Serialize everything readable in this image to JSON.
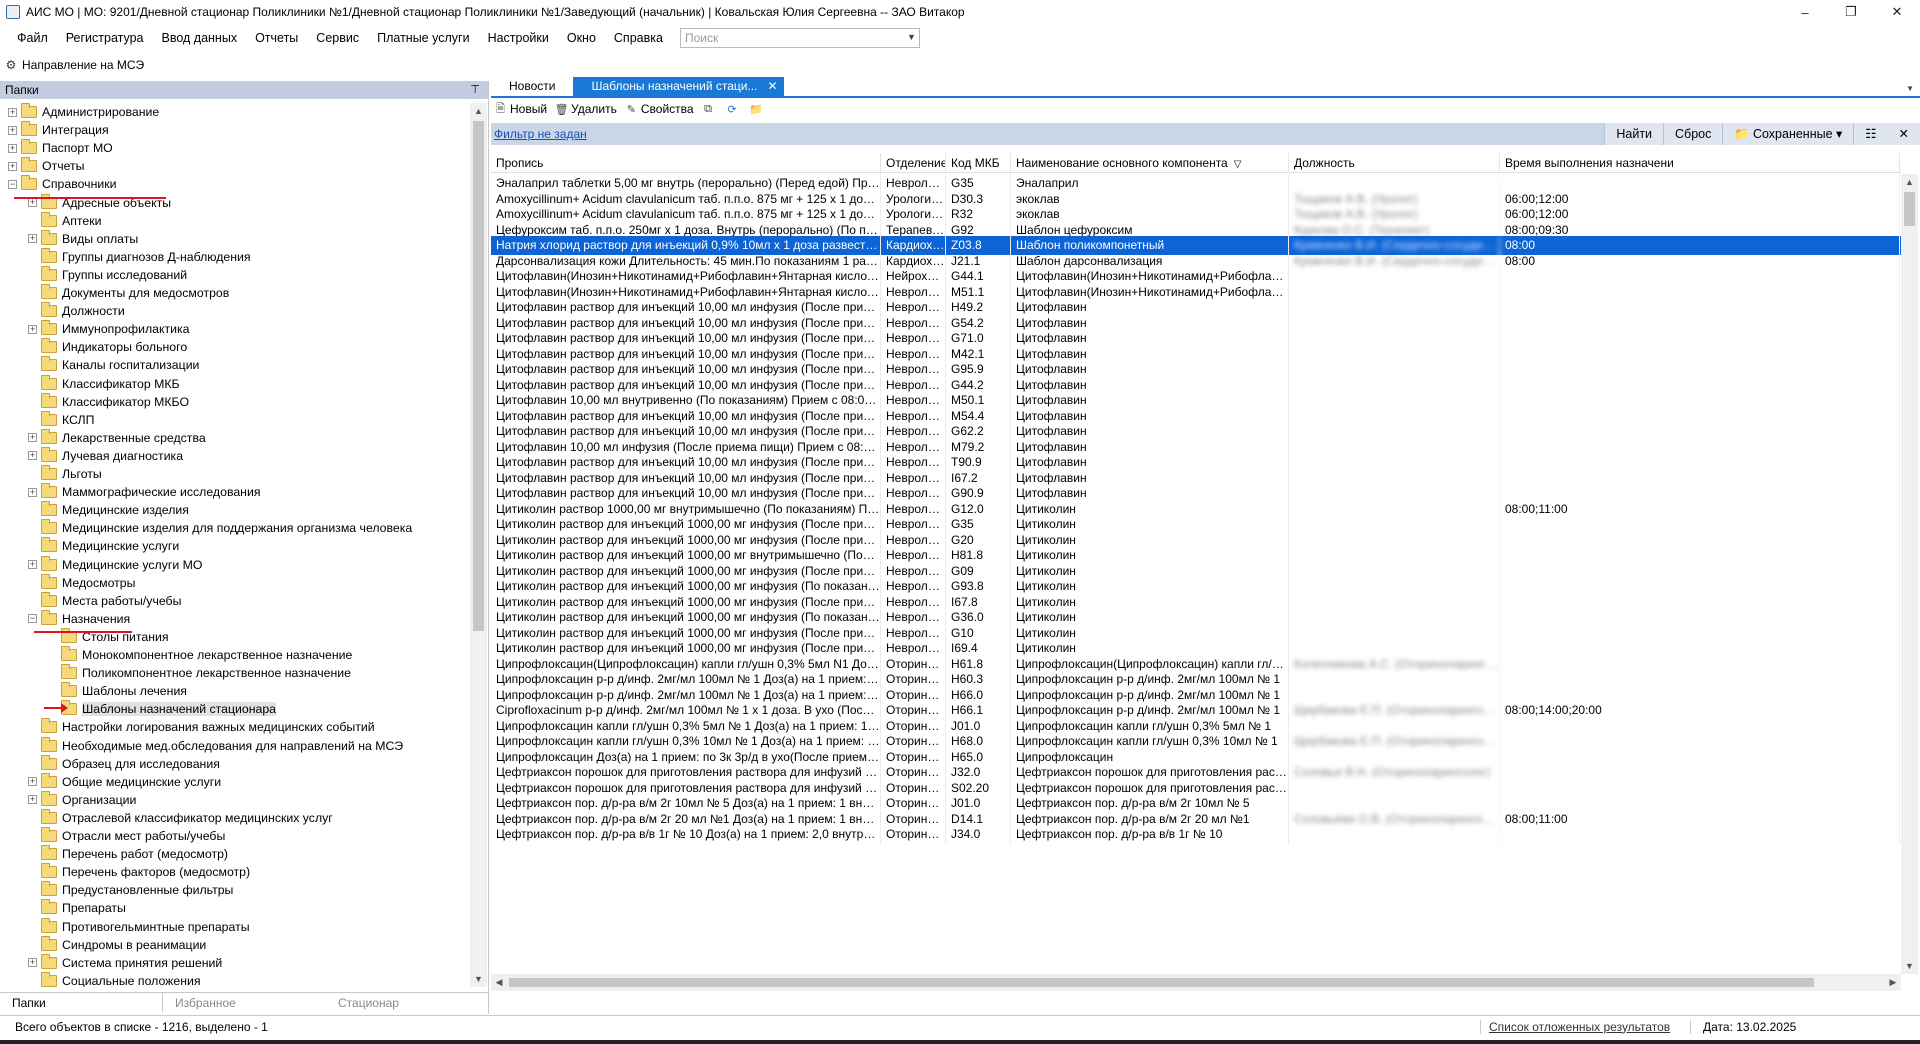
{
  "window": {
    "title": "АИС МО | МО: 9201/Дневной стационар Поликлиники №1/Дневной стационар Поликлиники №1/Заведующий (начальник) | Ковальская Юлия Сергеевна -- ЗАО Витакор"
  },
  "menu": {
    "items": [
      "Файл",
      "Регистратура",
      "Ввод данных",
      "Отчеты",
      "Сервис",
      "Платные услуги",
      "Настройки",
      "Окно",
      "Справка"
    ],
    "search_placeholder": "Поиск"
  },
  "toolbar1": {
    "mse_label": "Направление на МСЭ"
  },
  "left_panel": {
    "header": "Папки",
    "tree": [
      {
        "label": "Администрирование",
        "level": 0,
        "expandable": true
      },
      {
        "label": "Интеграция",
        "level": 0,
        "expandable": true
      },
      {
        "label": "Паспорт МО",
        "level": 0,
        "expandable": true
      },
      {
        "label": "Отчеты",
        "level": 0,
        "expandable": true
      },
      {
        "label": "Справочники",
        "level": 0,
        "expandable": true,
        "expanded": true
      },
      {
        "label": "Адресные объекты",
        "level": 1,
        "expandable": true
      },
      {
        "label": "Аптеки",
        "level": 1,
        "expandable": false
      },
      {
        "label": "Виды оплаты",
        "level": 1,
        "expandable": true
      },
      {
        "label": "Группы диагнозов Д-наблюдения",
        "level": 1,
        "expandable": false
      },
      {
        "label": "Группы исследований",
        "level": 1,
        "expandable": false
      },
      {
        "label": "Документы для медосмотров",
        "level": 1,
        "expandable": false
      },
      {
        "label": "Должности",
        "level": 1,
        "expandable": false
      },
      {
        "label": "Иммунопрофилактика",
        "level": 1,
        "expandable": true
      },
      {
        "label": "Индикаторы больного",
        "level": 1,
        "expandable": false
      },
      {
        "label": "Каналы госпитализации",
        "level": 1,
        "expandable": false
      },
      {
        "label": "Классификатор МКБ",
        "level": 1,
        "expandable": false
      },
      {
        "label": "Классификатор МКБО",
        "level": 1,
        "expandable": false
      },
      {
        "label": "КСЛП",
        "level": 1,
        "expandable": false
      },
      {
        "label": "Лекарственные средства",
        "level": 1,
        "expandable": true
      },
      {
        "label": "Лучевая диагностика",
        "level": 1,
        "expandable": true
      },
      {
        "label": "Льготы",
        "level": 1,
        "expandable": false
      },
      {
        "label": "Маммографические исследования",
        "level": 1,
        "expandable": true
      },
      {
        "label": "Медицинские изделия",
        "level": 1,
        "expandable": false
      },
      {
        "label": "Медицинские изделия для поддержания организма человека",
        "level": 1,
        "expandable": false
      },
      {
        "label": "Медицинские услуги",
        "level": 1,
        "expandable": false
      },
      {
        "label": "Медицинские услуги МО",
        "level": 1,
        "expandable": true
      },
      {
        "label": "Медосмотры",
        "level": 1,
        "expandable": false
      },
      {
        "label": "Места работы/учебы",
        "level": 1,
        "expandable": false
      },
      {
        "label": "Назначения",
        "level": 1,
        "expandable": true,
        "expanded": true
      },
      {
        "label": "Столы питания",
        "level": 2,
        "expandable": false
      },
      {
        "label": "Монокомпонентное лекарственное назначение",
        "level": 2,
        "expandable": false
      },
      {
        "label": "Поликомпонентное лекарственное назначение",
        "level": 2,
        "expandable": false
      },
      {
        "label": "Шаблоны лечения",
        "level": 2,
        "expandable": false
      },
      {
        "label": "Шаблоны назначений стационара",
        "level": 2,
        "expandable": false,
        "selected": true
      },
      {
        "label": "Настройки логирования важных медицинских событий",
        "level": 1,
        "expandable": false
      },
      {
        "label": "Необходимые мед.обследования для направлений на МСЭ",
        "level": 1,
        "expandable": false
      },
      {
        "label": "Образец для исследования",
        "level": 1,
        "expandable": false
      },
      {
        "label": "Общие медицинские услуги",
        "level": 1,
        "expandable": true
      },
      {
        "label": "Организации",
        "level": 1,
        "expandable": true
      },
      {
        "label": "Отраслевой классификатор медицинских услуг",
        "level": 1,
        "expandable": false
      },
      {
        "label": "Отрасли мест работы/учебы",
        "level": 1,
        "expandable": false
      },
      {
        "label": "Перечень работ (медосмотр)",
        "level": 1,
        "expandable": false
      },
      {
        "label": "Перечень факторов (медосмотр)",
        "level": 1,
        "expandable": false
      },
      {
        "label": "Предустановленные фильтры",
        "level": 1,
        "expandable": false
      },
      {
        "label": "Препараты",
        "level": 1,
        "expandable": false
      },
      {
        "label": "Противогельминтные препараты",
        "level": 1,
        "expandable": false
      },
      {
        "label": "Синдромы в реанимации",
        "level": 1,
        "expandable": false
      },
      {
        "label": "Система принятия решений",
        "level": 1,
        "expandable": true
      },
      {
        "label": "Социальные положения",
        "level": 1,
        "expandable": false
      }
    ],
    "bottom_tabs": [
      "Папки",
      "Избранное",
      "Стационар"
    ]
  },
  "right_panel": {
    "tabs": [
      "Новости",
      "Шаблоны назначений стаци..."
    ],
    "toolbar": {
      "new": "Новый",
      "delete": "Удалить",
      "properties": "Свойства"
    },
    "filter_link": "Фильтр не задан",
    "filter_buttons": {
      "find": "Найти",
      "reset": "Сброс",
      "saved": "Сохраненные"
    },
    "columns": [
      "Пропись",
      "Отделение",
      "Код МКБ",
      "Наименование основного компонента",
      "Должность",
      "Время выполнения назначени"
    ],
    "rows": [
      [
        "Эналаприл таблетки 5,00 мг  внутрь (перорально) (Перед едой)   Прием с 08:00 до 1...",
        "Невролог...",
        "G35",
        "Эналаприл",
        "",
        ""
      ],
      [
        "Amoxycillinum+ Acidum clavulanicum таб. п.п.о. 875 мг + 125 х 1 доза. Внутрь (перо...",
        "Урологич...",
        "D30.3",
        "экоклав",
        "Тощаков А.В. (Уролог)",
        "06:00;12:00"
      ],
      [
        "Amoxycillinum+ Acidum clavulanicum таб. п.п.о. 875 мг + 125 х 1 доза. Внутрь (перо...",
        "Урологич...",
        "R32",
        "экоклав",
        "Тощаков А.В. (Уролог)",
        "06:00;12:00"
      ],
      [
        "Цефуроксим таб. п.п.о. 250мг х 1 доза. Внутрь (перорально) (По показаниям) 2 раз...",
        "Терапевти...",
        "G92",
        "Шаблон цефуроксим",
        "Куркова О.С. (Терапевт)",
        "08:00;09:30"
      ],
      [
        "Натрия хлорид раствор для инъекций 0,9% 10мл х 1 доза развести в Цефазолин по...",
        "Кардиохи...",
        "Z03.8",
        "Шаблон поликомпонетный",
        "Кравченко В.И. (Сердечно-сосудистый хир...",
        "08:00"
      ],
      [
        "Дарсонвализация кожи Длительность: 45 мин.По показаниям 1 раз ежедневно в 08:0...",
        "Кардиохи...",
        "J21.1",
        "Шаблон дарсонвализация",
        "Кравченко В.И. (Сердечно-сосудистый хир...",
        "08:00"
      ],
      [
        "Цитофлавин(Инозин+Никотинамид+Рибофлавин+Янтарная кислота) раствор для ...",
        "Нейрохир...",
        "G44.1",
        "Цитофлавин(Инозин+Никотинамид+Рибофлавин+Янтар...",
        "",
        ""
      ],
      [
        "Цитофлавин(Инозин+Никотинамид+Рибофлавин+Янтарная кислота) раствор для ...",
        "Невролог...",
        "M51.1",
        "Цитофлавин(Инозин+Никотинамид+Рибофлавин+Янтар...",
        "",
        ""
      ],
      [
        "Цитофлавин раствор для инъекций 10,00 мл  инфузия (После приема пищи)   При...",
        "Невролог...",
        "H49.2",
        "Цитофлавин",
        "",
        ""
      ],
      [
        "Цитофлавин раствор для инъекций 10,00 мл  инфузия (После приема пищи)   При...",
        "Невролог...",
        "G54.2",
        "Цитофлавин",
        "",
        ""
      ],
      [
        "Цитофлавин раствор для инъекций 10,00 мл  инфузия (После приема пищи)   При...",
        "Невролог...",
        "G71.0",
        "Цитофлавин",
        "",
        ""
      ],
      [
        "Цитофлавин раствор для инъекций 10,00 мл  инфузия (После приема пищи)   При...",
        "Невролог...",
        "M42.1",
        "Цитофлавин",
        "",
        ""
      ],
      [
        "Цитофлавин раствор для инъекций 10,00 мл  инфузия (После приема пищи)   При...",
        "Невролог...",
        "G95.9",
        "Цитофлавин",
        "",
        ""
      ],
      [
        "Цитофлавин раствор для инъекций 10,00 мл  инфузия (После приема пищи)   При...",
        "Невролог...",
        "G44.2",
        "Цитофлавин",
        "",
        ""
      ],
      [
        "Цитофлавин 10,00 мл  внутривенно (По показаниям)   Прием с 08:00 до 11:00. 1 раз ...",
        "Невролог...",
        "M50.1",
        "Цитофлавин",
        "",
        ""
      ],
      [
        "Цитофлавин раствор для инъекций 10,00 мл  инфузия (После приема пищи)   При...",
        "Невролог...",
        "M54.4",
        "Цитофлавин",
        "",
        ""
      ],
      [
        "Цитофлавин раствор для инъекций 10,00 мл  инфузия (После приема пищи)   При...",
        "Невролог...",
        "G62.2",
        "Цитофлавин",
        "",
        ""
      ],
      [
        "Цитофлавин 10,00 мл  инфузия (После приема пищи)   Прием с 08:00 до 11:00. 1 ра...",
        "Невролог...",
        "M79.2",
        "Цитофлавин",
        "",
        ""
      ],
      [
        "Цитофлавин раствор для инъекций 10,00 мл  инфузия (После приема пищи)   При...",
        "Невролог...",
        "T90.9",
        "Цитофлавин",
        "",
        ""
      ],
      [
        "Цитофлавин раствор для инъекций 10,00 мл  инфузия (После приема пищи)   При...",
        "Невролог...",
        "I67.2",
        "Цитофлавин",
        "",
        ""
      ],
      [
        "Цитофлавин раствор для инъекций 10,00 мл  инфузия (После приема пищи)   При...",
        "Невролог...",
        "G90.9",
        "Цитофлавин",
        "",
        ""
      ],
      [
        "Цитиколин раствор 1000,00 мг  внутримышечно (По показаниям)   Прием с 08:00 д...",
        "Невролог...",
        "G12.0",
        "Цитиколин",
        "",
        "08:00;11:00"
      ],
      [
        "Цитиколин раствор для инъекций 1000,00 мг  инфузия (После приема пищи)   При...",
        "Невролог...",
        "G35",
        "Цитиколин",
        "",
        ""
      ],
      [
        "Цитиколин раствор для инъекций 1000,00 мг  инфузия (После приема пищи)   При...",
        "Невролог...",
        "G20",
        "Цитиколин",
        "",
        ""
      ],
      [
        "Цитиколин раствор для инъекций 1000,00 мг  внутримышечно (После приема пи...",
        "Невролог...",
        "H81.8",
        "Цитиколин",
        "",
        ""
      ],
      [
        "Цитиколин раствор для инъекций 1000,00 мг  инфузия (После приема пищи)   При...",
        "Невролог...",
        "G09",
        "Цитиколин",
        "",
        ""
      ],
      [
        "Цитиколин раствор для инъекций 1000,00 мг  инфузия (По показаниям)   Прием с 0...",
        "Невролог...",
        "G93.8",
        "Цитиколин",
        "",
        ""
      ],
      [
        "Цитиколин раствор для инъекций 1000,00 мг  инфузия (После приема пищи)   При...",
        "Невролог...",
        "I67.8",
        "Цитиколин",
        "",
        ""
      ],
      [
        "Цитиколин раствор для инъекций 1000,00 мг  инфузия (По показаниям)   Прием с 0...",
        "Невролог...",
        "G36.0",
        "Цитиколин",
        "",
        ""
      ],
      [
        "Цитиколин раствор для инъекций 1000,00 мг  инфузия (После приема пищи)   При...",
        "Невролог...",
        "G10",
        "Цитиколин",
        "",
        ""
      ],
      [
        "Цитиколин раствор для инъекций 1000,00 мг  инфузия (После приема пищи)   При...",
        "Невролог...",
        "I69.4",
        "Цитиколин",
        "",
        ""
      ],
      [
        "Ципрофлоксацин(Ципрофлоксацин) капли гл/ушн 0,3% 5мл N1 Доз(а) на 1 прием:...",
        "Оторинол...",
        "H61.8",
        "Ципрофлоксацин(Ципрофлоксацин) капли гл/ушн 0,3% ...",
        "Колесникова А.С. (Оториноларинголог)",
        ""
      ],
      [
        "Ципрофлоксацин р-р д/инф. 2мг/мл 100мл № 1 Доз(а) на 1 прием: по 3к в правое ...",
        "Оторинол...",
        "H60.3",
        "Ципрофлоксацин р-р д/инф. 2мг/мл 100мл № 1",
        "",
        ""
      ],
      [
        "Ципрофлоксацин р-р д/инф. 2мг/мл 100мл № 1 Доз(а) на 1 прием: по 3к в ухо (По...",
        "Оторинол...",
        "H66.0",
        "Ципрофлоксацин р-р д/инф. 2мг/мл 100мл № 1",
        "",
        ""
      ],
      [
        "Ciprofloxacinum р-р д/инф. 2мг/мл 100мл № 1 х 1 доза. В ухо (После приема пищи...",
        "Оторинол...",
        "H66.1",
        "Ципрофлоксацин р-р д/инф. 2мг/мл 100мл № 1",
        "Щербакова Е.П. (Оториноларинголог)",
        "08:00;14:00;20:00"
      ],
      [
        "Ципрофлоксацин капли гл/ушн 0,3% 5мл № 1 Доз(а) на 1 прием: 1  наружно (Посл...",
        "Оторинол...",
        "J01.0",
        "Ципрофлоксацин капли гл/ушн 0,3% 5мл № 1",
        "",
        ""
      ],
      [
        "Ципрофлоксацин капли гл/ушн 0,3% 10мл № 1 Доз(а) на 1 прием: по 3к 3р/д в оба ...",
        "Оторинол...",
        "H68.0",
        "Ципрофлоксацин капли гл/ушн 0,3% 10мл № 1",
        "Щербакова Е.П. (Оториноларинголог)",
        ""
      ],
      [
        "Ципрофлоксацин Доз(а) на 1 прием: по 3к 3р/д в ухо(После приема пищи) ...",
        "Оторинол...",
        "H65.0",
        "Ципрофлоксацин",
        "",
        ""
      ],
      [
        "Цефтриаксон порошок для приготовления раствора для инфузий 2г № 1 Доз(а) на ...",
        "Оторинол...",
        "J32.0",
        "Цефтриаксон порошок для приготовления раствора для ...",
        "Соловья В.Н. (Оториноларинголог)",
        ""
      ],
      [
        "Цефтриаксон порошок для приготовления раствора для инфузий 2г № 1 Доз(а) на ...",
        "Оторинол...",
        "S02.20",
        "Цефтриаксон порошок для приготовления раствора для ...",
        "",
        ""
      ],
      [
        "Цефтриаксон пор. д/р-ра в/м 2г 10мл № 5 Доз(а) на 1 прием: 1  внутримышечно (...",
        "Оторинол...",
        "J01.0",
        "Цефтриаксон пор. д/р-ра в/м 2г 10мл № 5",
        "",
        ""
      ],
      [
        "Цефтриаксон пор. д/р-ра в/м 2г 20 мл №1 Доз(а) на 1 прием: 1  внутримышечно (...",
        "Оторинол...",
        "D14.1",
        "Цефтриаксон пор. д/р-ра в/м 2г 20 мл №1",
        "Соловьёва О.В. (Оториноларинголог)",
        "08:00;11:00"
      ],
      [
        "Цефтриаксон пор. д/р-ра в/в 1г № 10 Доз(а) на 1 прием: 2,0  внутримышечно (Пос...",
        "Оторинол...",
        "J34.0",
        "Цефтриаксон пор. д/р-ра в/в 1г № 10",
        "",
        ""
      ]
    ],
    "selected_row": 4
  },
  "status": {
    "count": "Всего объектов в списке - 1216, выделено - 1",
    "deferred": "Список отложенных результатов",
    "date": "Дата: 13.02.2025"
  }
}
